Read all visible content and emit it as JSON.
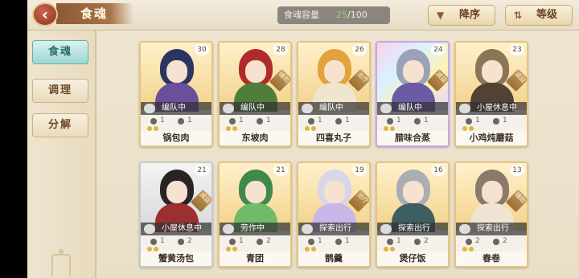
{
  "header": {
    "title": "食魂",
    "capacity_label": "食魂容量",
    "capacity_current": "25",
    "capacity_total": "/100",
    "sort_desc": "降序",
    "sort_level": "等级"
  },
  "sidebar": {
    "items": [
      {
        "label": "食魂",
        "active": true
      },
      {
        "label": "调理",
        "active": false
      },
      {
        "label": "分解",
        "active": false
      }
    ]
  },
  "cards": [
    {
      "name": "锅包肉",
      "level": "30",
      "status": "编队中",
      "tag": "",
      "stat_left": "1",
      "stat_right": "1",
      "rarity": "gold",
      "hair": "#2b3660",
      "outfit": "#6b4e9c"
    },
    {
      "name": "东坡肉",
      "level": "28",
      "status": "编队中",
      "tag": "辅助",
      "stat_left": "1",
      "stat_right": "1",
      "rarity": "gold",
      "hair": "#b02a2a",
      "outfit": "#4f7e3a"
    },
    {
      "name": "四喜丸子",
      "level": "26",
      "status": "编队中",
      "tag": "治疗",
      "stat_left": "1",
      "stat_right": "1",
      "rarity": "gold",
      "hair": "#e3a23b",
      "outfit": "#f0e6d0"
    },
    {
      "name": "腊味合蒸",
      "level": "24",
      "status": "编队中",
      "tag": "减益",
      "stat_left": "1",
      "stat_right": "1",
      "rarity": "rainbow",
      "hair": "#9aa2b8",
      "outfit": "#6b5aa5"
    },
    {
      "name": "小鸡炖蘑菇",
      "level": "23",
      "status": "小屋休息中",
      "tag": "减益",
      "stat_left": "1",
      "stat_right": "1",
      "rarity": "gold",
      "hair": "#8a7557",
      "outfit": "#514234"
    },
    {
      "name": "蟹黄汤包",
      "level": "21",
      "status": "小屋休息中",
      "tag": "减益",
      "stat_left": "1",
      "stat_right": "2",
      "rarity": "silver",
      "hair": "#2a2324",
      "outfit": "#9c2f2f"
    },
    {
      "name": "青团",
      "level": "21",
      "status": "劳作中",
      "tag": "",
      "stat_left": "1",
      "stat_right": "2",
      "rarity": "gold",
      "hair": "#3f8a4a",
      "outfit": "#6fbb6a"
    },
    {
      "name": "鹊羹",
      "level": "19",
      "status": "探索出行",
      "tag": "治疗",
      "stat_left": "1",
      "stat_right": "1",
      "rarity": "gold",
      "hair": "#d9d6e7",
      "outfit": "#cbb6ea"
    },
    {
      "name": "煲仔饭",
      "level": "16",
      "status": "探索出行",
      "tag": "",
      "stat_left": "1",
      "stat_right": "2",
      "rarity": "gold",
      "hair": "#a9aeb2",
      "outfit": "#3e5f62"
    },
    {
      "name": "春卷",
      "level": "13",
      "status": "探索出行",
      "tag": "辅助",
      "stat_left": "2",
      "stat_right": "2",
      "rarity": "gold",
      "hair": "#8a7a6a",
      "outfit": "#f1e4d4"
    }
  ]
}
